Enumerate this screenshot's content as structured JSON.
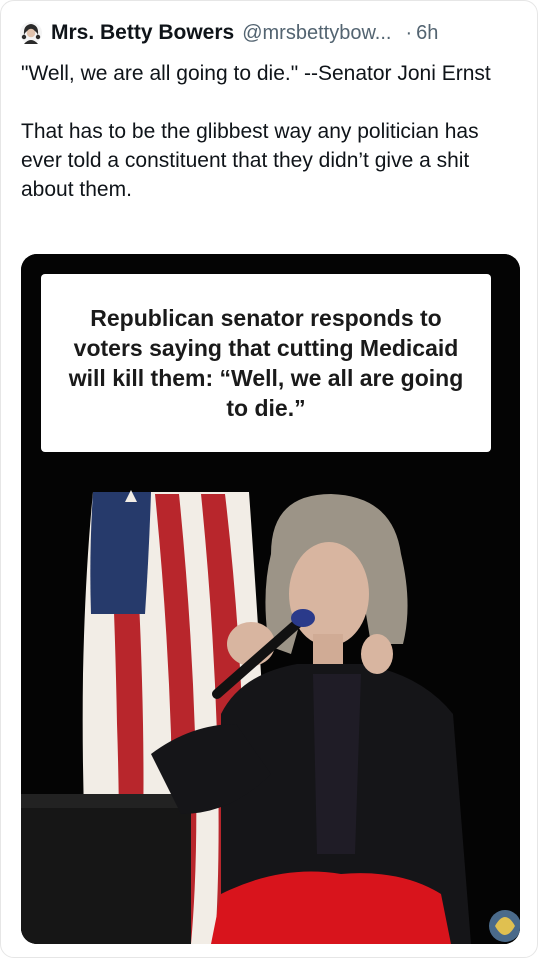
{
  "post": {
    "author_name": "Mrs. Betty Bowers",
    "handle": "@mrsbettybow...",
    "separator": "·",
    "time": "6h",
    "avatar_icon": "woman-avatar",
    "text_line_1": "\"Well, we are all going to die.\" --Senator Joni Ernst",
    "text_line_2": "That has to be the glibbest way any politician has ever told a constituent that they didn’t give a shit about them."
  },
  "media": {
    "caption": "Republican senator responds to voters saying that cutting Medicaid will kill them: “Well, we all are going to die.”",
    "colors": {
      "background": "#040404",
      "flag_red": "#b8262c",
      "flag_white": "#f2ede6",
      "flag_blue": "#263a6b",
      "jacket": "#151518",
      "hair": "#9c9487",
      "skin": "#d8b5a0",
      "pants": "#d8141c"
    }
  }
}
